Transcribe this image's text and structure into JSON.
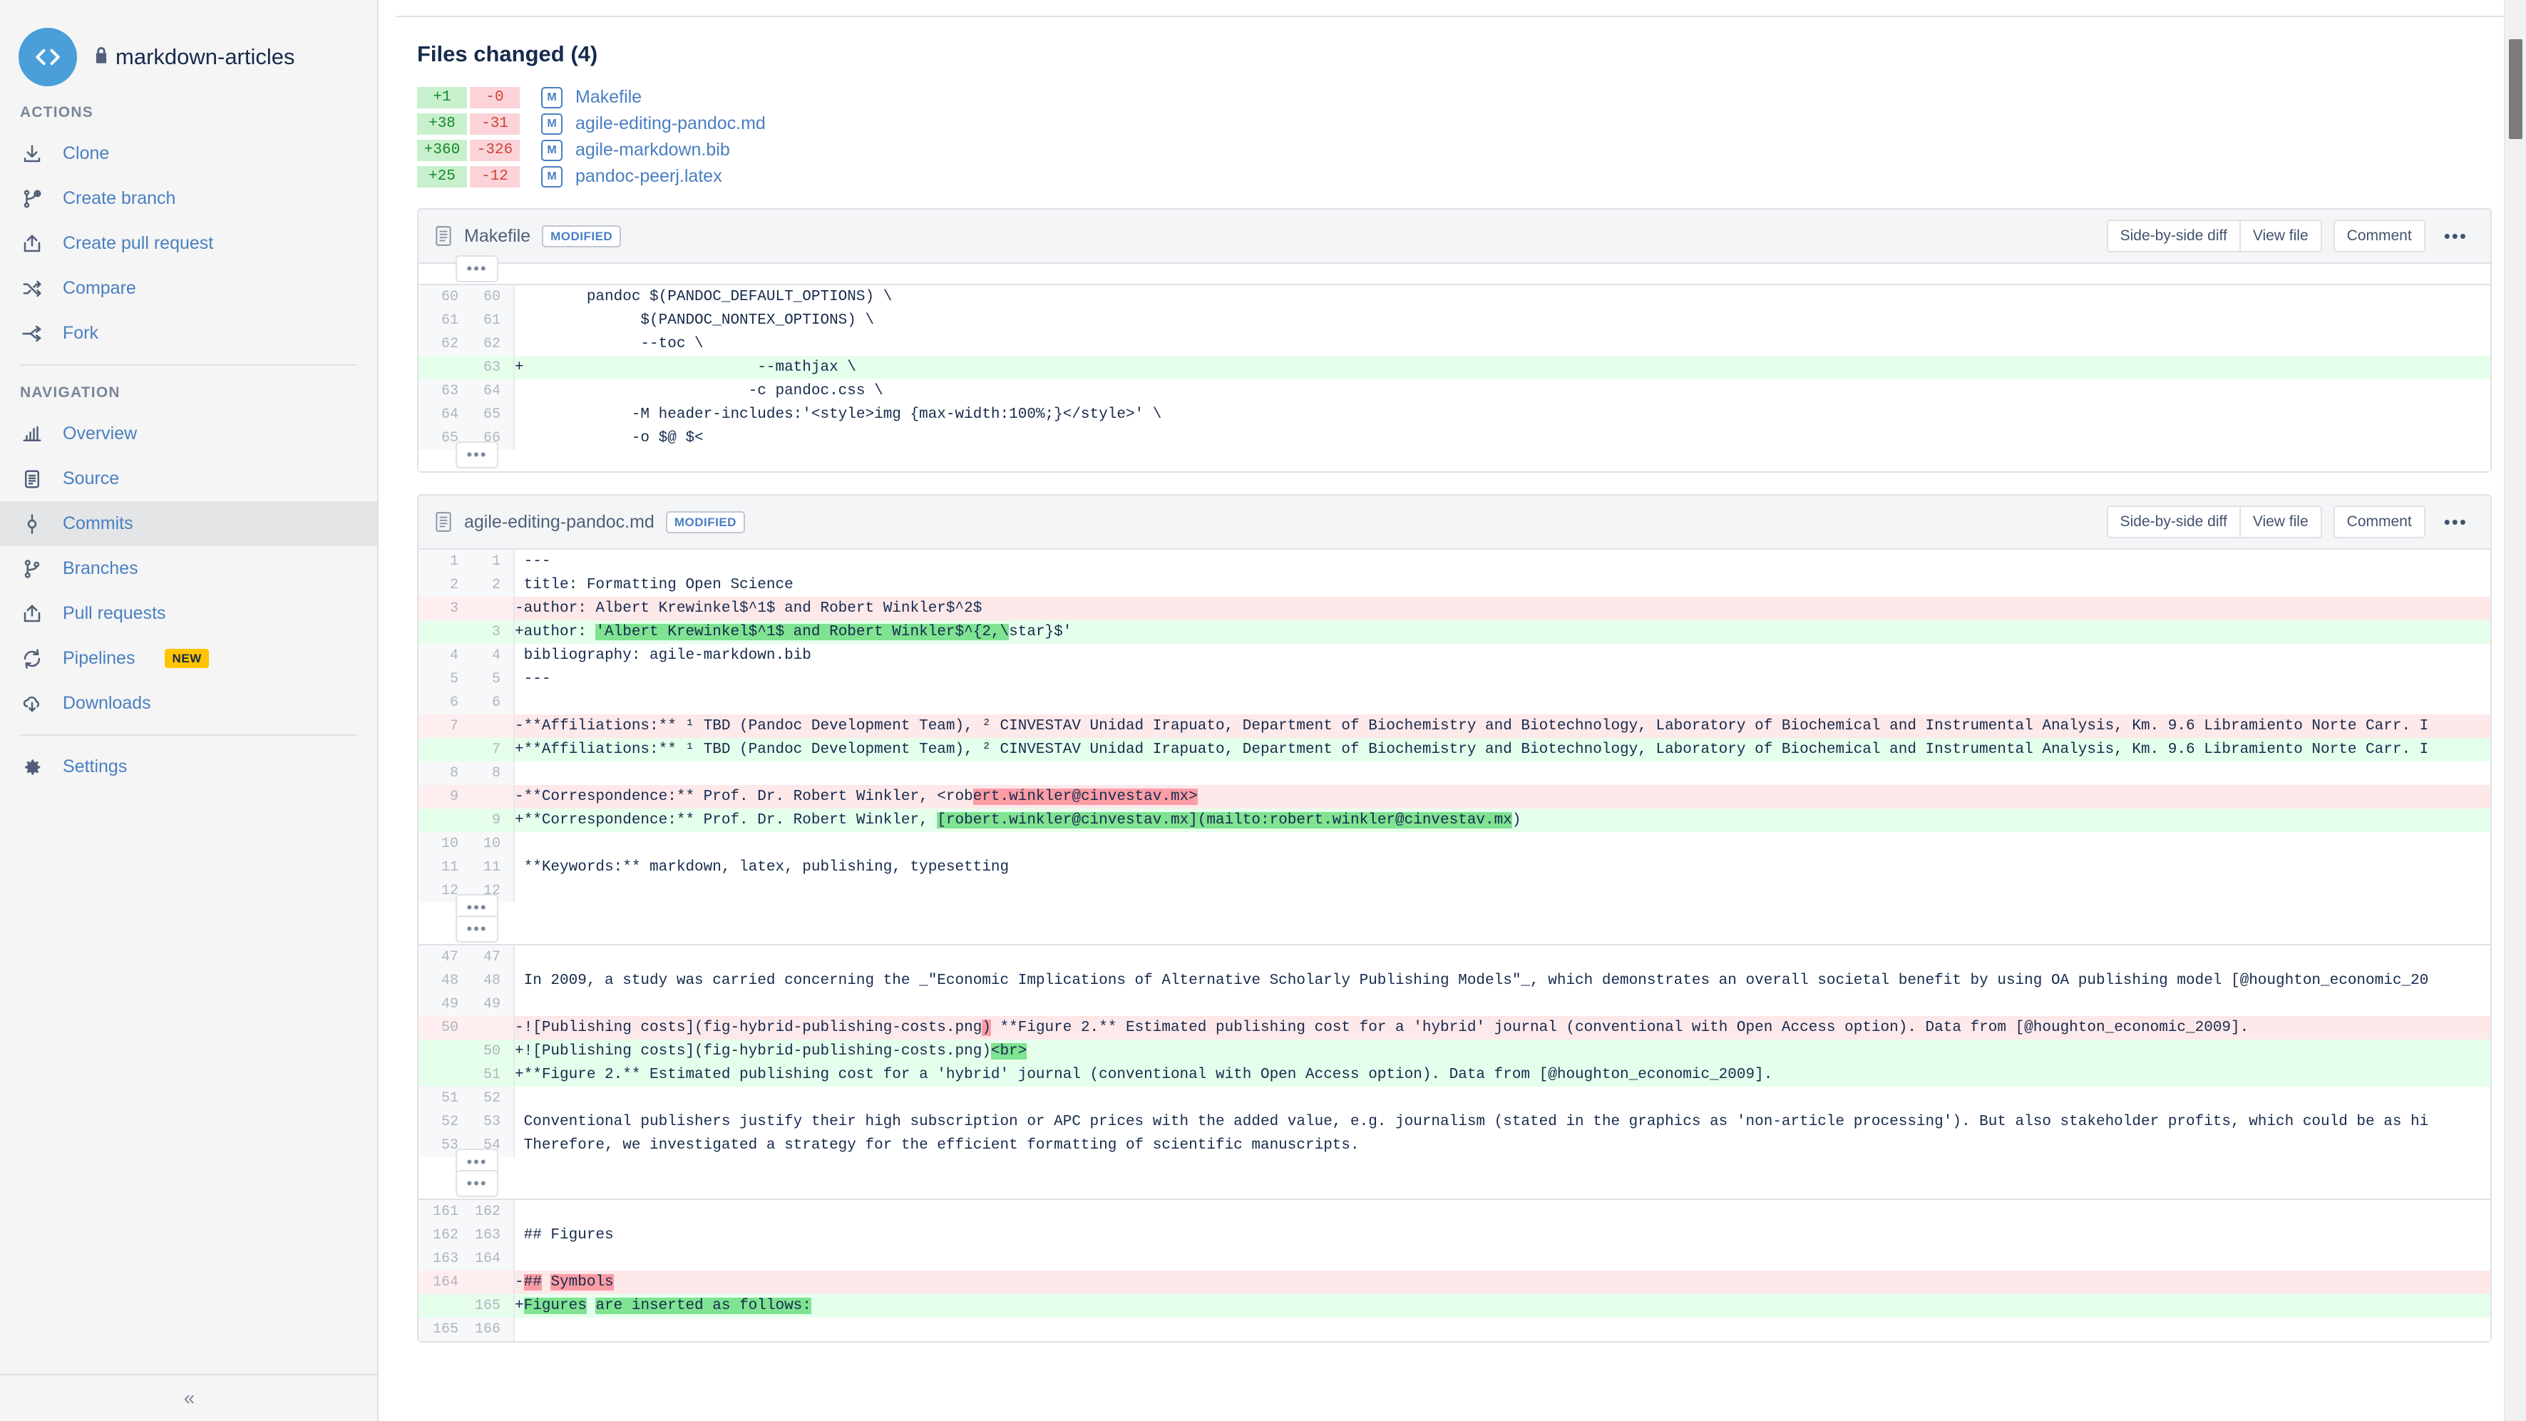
{
  "sidebar": {
    "repo": {
      "name": "markdown-articles",
      "lock_icon": "lock-icon",
      "avatar_icon": "code-brackets-icon"
    },
    "actions_label": "ACTIONS",
    "actions": [
      {
        "label": "Clone",
        "icon": "download-icon"
      },
      {
        "label": "Create branch",
        "icon": "branch-plus-icon"
      },
      {
        "label": "Create pull request",
        "icon": "pull-request-icon"
      },
      {
        "label": "Compare",
        "icon": "compare-icon"
      },
      {
        "label": "Fork",
        "icon": "fork-icon"
      }
    ],
    "navigation_label": "NAVIGATION",
    "navigation": [
      {
        "label": "Overview",
        "icon": "chart-icon",
        "selected": false,
        "badge": ""
      },
      {
        "label": "Source",
        "icon": "document-icon",
        "selected": false,
        "badge": ""
      },
      {
        "label": "Commits",
        "icon": "commit-node-icon",
        "selected": true,
        "badge": ""
      },
      {
        "label": "Branches",
        "icon": "branch-icon",
        "selected": false,
        "badge": ""
      },
      {
        "label": "Pull requests",
        "icon": "pull-request-icon",
        "selected": false,
        "badge": ""
      },
      {
        "label": "Pipelines",
        "icon": "pipelines-icon",
        "selected": false,
        "badge": "NEW"
      },
      {
        "label": "Downloads",
        "icon": "cloud-download-icon",
        "selected": false,
        "badge": ""
      }
    ],
    "settings": {
      "label": "Settings",
      "icon": "gear-icon"
    },
    "collapse_glyph": "«"
  },
  "main": {
    "files_changed_title": "Files changed (4)",
    "file_summary": [
      {
        "added": "+1",
        "removed": "-0",
        "status": "M",
        "name": "Makefile"
      },
      {
        "added": "+38",
        "removed": "-31",
        "status": "M",
        "name": "agile-editing-pandoc.md"
      },
      {
        "added": "+360",
        "removed": "-326",
        "status": "M",
        "name": "agile-markdown.bib"
      },
      {
        "added": "+25",
        "removed": "-12",
        "status": "M",
        "name": "pandoc-peerj.latex"
      }
    ],
    "buttons": {
      "side_by_side": "Side-by-side diff",
      "view_file": "View file",
      "comment": "Comment",
      "more": "•••",
      "expander": "•••"
    },
    "diffs": [
      {
        "file": "Makefile",
        "status_badge": "MODIFIED",
        "hunks": [
          {
            "expander_top": true,
            "expander_bottom": true,
            "lines": [
              {
                "type": "ctx",
                "old": "60",
                "new": "60",
                "marker": " ",
                "text": "       pandoc $(PANDOC_DEFAULT_OPTIONS) \\"
              },
              {
                "type": "ctx",
                "old": "61",
                "new": "61",
                "marker": " ",
                "text": "             $(PANDOC_NONTEX_OPTIONS) \\"
              },
              {
                "type": "ctx",
                "old": "62",
                "new": "62",
                "marker": " ",
                "text": "             --toc \\"
              },
              {
                "type": "add",
                "old": "",
                "new": "63",
                "marker": "+",
                "text": "                          --mathjax \\"
              },
              {
                "type": "ctx",
                "old": "63",
                "new": "64",
                "marker": " ",
                "text": "                         -c pandoc.css \\"
              },
              {
                "type": "ctx",
                "old": "64",
                "new": "65",
                "marker": " ",
                "text": "            -M header-includes:'<style>img {max-width:100%;}</style>' \\"
              },
              {
                "type": "ctx",
                "old": "65",
                "new": "66",
                "marker": " ",
                "text": "            -o $@ $<"
              }
            ]
          }
        ]
      },
      {
        "file": "agile-editing-pandoc.md",
        "status_badge": "MODIFIED",
        "hunks": [
          {
            "expander_top": false,
            "expander_bottom": true,
            "lines": [
              {
                "type": "ctx",
                "old": "1",
                "new": "1",
                "marker": " ",
                "text": "---"
              },
              {
                "type": "ctx",
                "old": "2",
                "new": "2",
                "marker": " ",
                "text": "title: Formatting Open Science"
              },
              {
                "type": "del",
                "old": "3",
                "new": "",
                "marker": "-",
                "text": "author: Albert Krewinkel$^1$ and Robert Winkler$^2$"
              },
              {
                "type": "add",
                "old": "",
                "new": "3",
                "marker": "+",
                "text": "author: 'Albert Krewinkel$^1$ and Robert Winkler$^{2,\\star}$'",
                "hl": [
                  [
                    8,
                    54
                  ]
                ]
              },
              {
                "type": "ctx",
                "old": "4",
                "new": "4",
                "marker": " ",
                "text": "bibliography: agile-markdown.bib"
              },
              {
                "type": "ctx",
                "old": "5",
                "new": "5",
                "marker": " ",
                "text": "---"
              },
              {
                "type": "ctx",
                "old": "6",
                "new": "6",
                "marker": " ",
                "text": ""
              },
              {
                "type": "del",
                "old": "7",
                "new": "",
                "marker": "-",
                "text": "**Affiliations:** ¹ TBD (Pandoc Development Team), ² CINVESTAV Unidad Irapuato, Department of Biochemistry and Biotechnology, Laboratory of Biochemical and Instrumental Analysis, Km. 9.6 Libramiento Norte Carr. I"
              },
              {
                "type": "add",
                "old": "",
                "new": "7",
                "marker": "+",
                "text": "**Affiliations:** ¹ TBD (Pandoc Development Team), ² CINVESTAV Unidad Irapuato, Department of Biochemistry and Biotechnology, Laboratory of Biochemical and Instrumental Analysis, Km. 9.6 Libramiento Norte Carr. I"
              },
              {
                "type": "ctx",
                "old": "8",
                "new": "8",
                "marker": " ",
                "text": ""
              },
              {
                "type": "del",
                "old": "9",
                "new": "",
                "marker": "-",
                "text": "**Correspondence:** Prof. Dr. Robert Winkler, <robert.winkler@cinvestav.mx>",
                "hl": [
                  [
                    50,
                    76
                  ]
                ]
              },
              {
                "type": "add",
                "old": "",
                "new": "9",
                "marker": "+",
                "text": "**Correspondence:** Prof. Dr. Robert Winkler, [robert.winkler@cinvestav.mx](mailto:robert.winkler@cinvestav.mx)",
                "hl": [
                  [
                    46,
                    76
                  ],
                  [
                    76,
                    110
                  ]
                ]
              },
              {
                "type": "ctx",
                "old": "10",
                "new": "10",
                "marker": " ",
                "text": ""
              },
              {
                "type": "ctx",
                "old": "11",
                "new": "11",
                "marker": " ",
                "text": "**Keywords:** markdown, latex, publishing, typesetting"
              },
              {
                "type": "ctx",
                "old": "12",
                "new": "12",
                "marker": " ",
                "text": ""
              }
            ]
          },
          {
            "expander_top": true,
            "expander_bottom": true,
            "lines": [
              {
                "type": "ctx",
                "old": "47",
                "new": "47",
                "marker": " ",
                "text": ""
              },
              {
                "type": "ctx",
                "old": "48",
                "new": "48",
                "marker": " ",
                "text": "In 2009, a study was carried concerning the _\"Economic Implications of Alternative Scholarly Publishing Models\"_, which demonstrates an overall societal benefit by using OA publishing model [@houghton_economic_20"
              },
              {
                "type": "ctx",
                "old": "49",
                "new": "49",
                "marker": " ",
                "text": ""
              },
              {
                "type": "del",
                "old": "50",
                "new": "",
                "marker": "-",
                "text": "![Publishing costs](fig-hybrid-publishing-costs.png) **Figure 2.** Estimated publishing cost for a 'hybrid' journal (conventional with Open Access option). Data from [@houghton_economic_2009].",
                "hl": [
                  [
                    51,
                    52
                  ]
                ]
              },
              {
                "type": "add",
                "old": "",
                "new": "50",
                "marker": "+",
                "text": "![Publishing costs](fig-hybrid-publishing-costs.png)<br>",
                "hl": [
                  [
                    52,
                    56
                  ]
                ]
              },
              {
                "type": "add",
                "old": "",
                "new": "51",
                "marker": "+",
                "text": "**Figure 2.** Estimated publishing cost for a 'hybrid' journal (conventional with Open Access option). Data from [@houghton_economic_2009]."
              },
              {
                "type": "ctx",
                "old": "51",
                "new": "52",
                "marker": " ",
                "text": ""
              },
              {
                "type": "ctx",
                "old": "52",
                "new": "53",
                "marker": " ",
                "text": "Conventional publishers justify their high subscription or APC prices with the added value, e.g. journalism (stated in the graphics as 'non-article processing'). But also stakeholder profits, which could be as hi"
              },
              {
                "type": "ctx",
                "old": "53",
                "new": "54",
                "marker": " ",
                "text": "Therefore, we investigated a strategy for the efficient formatting of scientific manuscripts."
              }
            ]
          },
          {
            "expander_top": true,
            "expander_bottom": false,
            "lines": [
              {
                "type": "ctx",
                "old": "161",
                "new": "162",
                "marker": " ",
                "text": ""
              },
              {
                "type": "ctx",
                "old": "162",
                "new": "163",
                "marker": " ",
                "text": "## Figures"
              },
              {
                "type": "ctx",
                "old": "163",
                "new": "164",
                "marker": " ",
                "text": ""
              },
              {
                "type": "del",
                "old": "164",
                "new": "",
                "marker": "-",
                "text": "## Symbols",
                "hl": [
                  [
                    0,
                    2
                  ],
                  [
                    3,
                    10
                  ]
                ]
              },
              {
                "type": "add",
                "old": "",
                "new": "165",
                "marker": "+",
                "text": "Figures are inserted as follows:",
                "hl": [
                  [
                    0,
                    7
                  ],
                  [
                    8,
                    32
                  ]
                ]
              },
              {
                "type": "ctx",
                "old": "165",
                "new": "166",
                "marker": " ",
                "text": ""
              }
            ]
          }
        ]
      }
    ]
  },
  "scrollbar": {
    "name": "vertical-scrollbar"
  }
}
